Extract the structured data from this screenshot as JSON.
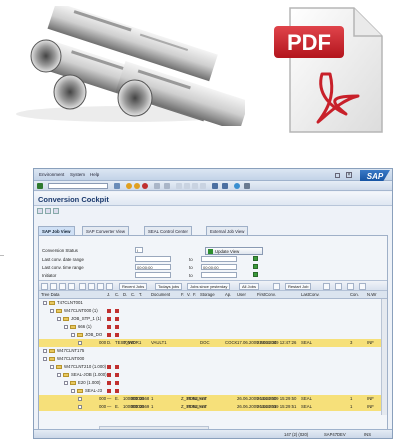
{
  "window": {
    "menu": [
      "Environment",
      "System",
      "Help"
    ],
    "logo": "SAP",
    "title": "Conversion Cockpit"
  },
  "tabs": [
    "SAP Job View",
    "SAP Converter View",
    "SEAL Control Center",
    "External Job View"
  ],
  "form": {
    "rows": [
      {
        "label": "Conversion Status",
        "from": "I",
        "to": ""
      },
      {
        "label": "Last conv. date range",
        "from": "",
        "to_label": "to",
        "to": ""
      },
      {
        "label": "Last conv. time range",
        "from": "00:00:00",
        "to_label": "to",
        "to": "00:00:00"
      },
      {
        "label": "Initiator",
        "from": "",
        "to_label": "to",
        "to": ""
      }
    ],
    "update_button": "Update View"
  },
  "grid_toolbar": {
    "buttons": [
      "Recent Jobs",
      "Todays jobs",
      "Jobs since yesterday",
      "All Jobs",
      "Restart Job"
    ]
  },
  "columns": [
    "Tree Data",
    "J.",
    "C.",
    "D.",
    "C.",
    "T.",
    "Document",
    "F.",
    "V.",
    "F.",
    "Storage",
    "Ap.",
    "User",
    "FirstConv.",
    "LastConv.",
    "Con.",
    "N.Wr"
  ],
  "rows": [
    {
      "tree": "T47CLNT001",
      "indent": 0,
      "sel": false
    },
    {
      "tree": "W47CLNT000 (1)",
      "indent": 1,
      "sel": false
    },
    {
      "tree": "JOB_STP_1 (1)",
      "indent": 2,
      "sel": false
    },
    {
      "tree": "666 (1)",
      "indent": 3,
      "sel": false
    },
    {
      "tree": "JOB_DO",
      "indent": 4,
      "sel": false
    },
    {
      "tree": "",
      "indent": 5,
      "sel": true,
      "cells": [
        "000",
        "D.",
        "TEST_WOR.",
        "000",
        "00",
        "1",
        "VAULT1",
        "",
        "",
        "",
        "DOC",
        "COCK.",
        "17.06.2009 08:35:34",
        "22.06.2009 12:47:26",
        "SEAL",
        "3",
        "INF"
      ]
    },
    {
      "tree": "W47CLNT175",
      "indent": 0,
      "sel": false
    },
    {
      "tree": "W47CLNT000",
      "indent": 0,
      "sel": false
    },
    {
      "tree": "W47CLNT210 (1.000)",
      "indent": 1,
      "sel": false
    },
    {
      "tree": "SEAL-JOB (1.000)",
      "indent": 2,
      "sel": false
    },
    {
      "tree": "E20 (1.000)",
      "indent": 3,
      "sel": false
    },
    {
      "tree": "SEAL-J3",
      "indent": 4,
      "sel": false
    },
    {
      "tree": "",
      "indent": 5,
      "sel": true,
      "cells": [
        "000",
        "—",
        "E.",
        "10000003668",
        "000",
        "00",
        "1",
        "Z_SEAL_VAT",
        "PDF",
        "SEAL8",
        "",
        "",
        "26.06.2009 15:29:50",
        "26.06.2009 15:29:50",
        "SEAL",
        "1",
        "INF"
      ]
    },
    {
      "tree": "",
      "indent": 5,
      "sel": true,
      "cells": [
        "000",
        "—",
        "E.",
        "10000003669",
        "000",
        "00",
        "1",
        "Z_SEAL_VAT",
        "PDF",
        "SEAL8",
        "",
        "",
        "26.06.2009 15:29:51",
        "26.06.2009 15:29:51",
        "SEAL",
        "1",
        "INF"
      ]
    }
  ],
  "status": {
    "text": "147 (2) (020)",
    "sys": "SAP47DEV",
    "mode": "INS"
  },
  "colors": {
    "accent": "#1d3b6e",
    "selection": "#f6e07a",
    "pdf_red": "#c8202a"
  }
}
